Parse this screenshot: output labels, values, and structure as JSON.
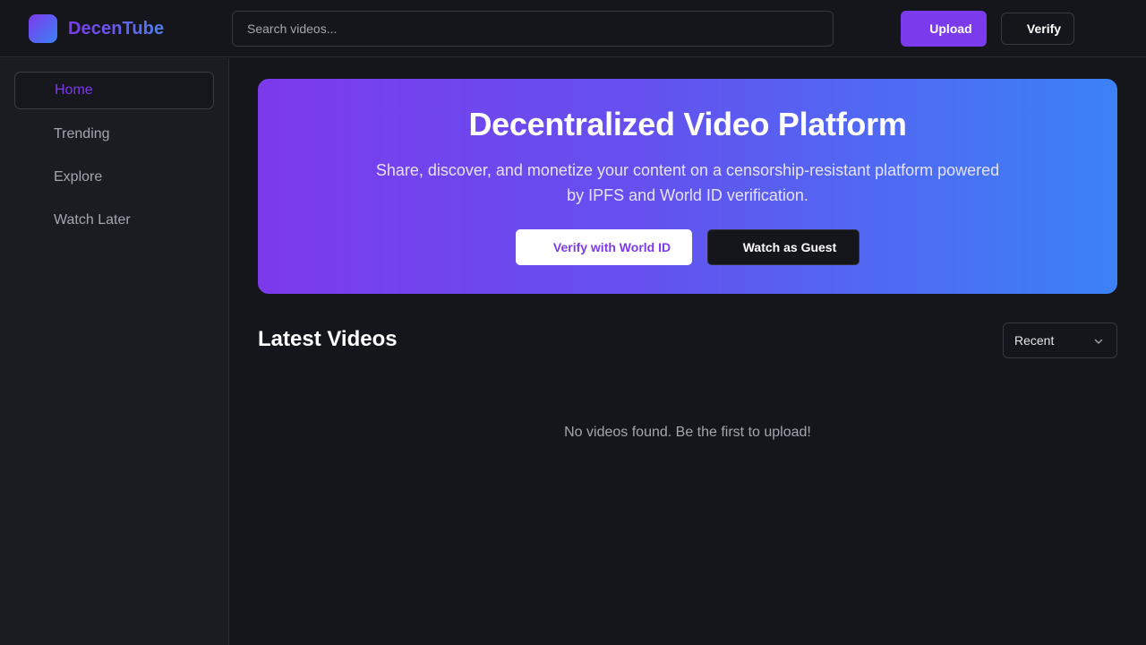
{
  "header": {
    "brand": "DecenTube",
    "search_placeholder": "Search videos...",
    "upload_label": "Upload",
    "verify_label": "Verify"
  },
  "sidebar": {
    "items": [
      {
        "label": "Home",
        "active": true
      },
      {
        "label": "Trending",
        "active": false
      },
      {
        "label": "Explore",
        "active": false
      },
      {
        "label": "Watch Later",
        "active": false
      }
    ]
  },
  "hero": {
    "title": "Decentralized Video Platform",
    "subtitle": "Share, discover, and monetize your content on a censorship-resistant platform powered by IPFS and World ID verification.",
    "primary_button": "Verify with World ID",
    "secondary_button": "Watch as Guest"
  },
  "videos": {
    "heading": "Latest Videos",
    "sort_selected": "Recent",
    "empty_message": "No videos found. Be the first to upload!"
  },
  "colors": {
    "accent": "#7c3aed",
    "accent_blue": "#3b82f6",
    "background": "#15161b",
    "sidebar": "#1a1c22"
  }
}
